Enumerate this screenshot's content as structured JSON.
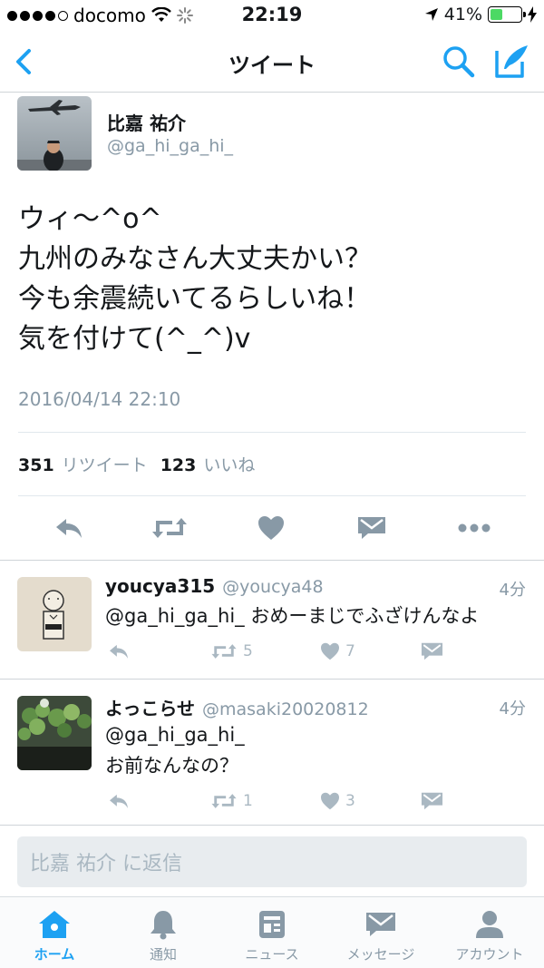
{
  "status_bar": {
    "carrier": "docomo",
    "time": "22:19",
    "battery_percent": "41%",
    "battery_level": 0.41,
    "accent_color": "#4cd964"
  },
  "nav": {
    "title": "ツイート",
    "back_icon": "chevron-left-icon",
    "search_icon": "search-icon",
    "compose_icon": "compose-icon",
    "accent_color": "#1da1f2"
  },
  "main_tweet": {
    "author_name": "比嘉 祐介",
    "author_handle": "@ga_hi_ga_hi_",
    "text": "ウィ〜^o^\n九州のみなさん大丈夫かい？\n今も余震続いてるらしいね！\n気を付けて(^_^)v",
    "timestamp": "2016/04/14 22:10",
    "retweet_count": "351",
    "retweet_label": "リツイート",
    "like_count": "123",
    "like_label": "いいね",
    "actions": [
      "reply-icon",
      "retweet-icon",
      "like-icon",
      "message-icon",
      "more-icon"
    ]
  },
  "replies": [
    {
      "name": "youcya315",
      "handle": "@youcya48",
      "time": "4分",
      "text": "@ga_hi_ga_hi_ おめーまじでふざけんなよ",
      "retweets": "5",
      "likes": "7"
    },
    {
      "name": "よっこらせ",
      "handle": "@masaki20020812",
      "time": "4分",
      "text": "@ga_hi_ga_hi_\nお前なんなの？",
      "retweets": "1",
      "likes": "3"
    }
  ],
  "reply_box": {
    "placeholder": "比嘉 祐介 に返信"
  },
  "tabbar": {
    "items": [
      {
        "label": "ホーム",
        "icon": "home-icon",
        "active": true
      },
      {
        "label": "通知",
        "icon": "bell-icon",
        "active": false
      },
      {
        "label": "ニュース",
        "icon": "news-icon",
        "active": false
      },
      {
        "label": "メッセージ",
        "icon": "envelope-icon",
        "active": false
      },
      {
        "label": "アカウント",
        "icon": "person-icon",
        "active": false
      }
    ]
  }
}
